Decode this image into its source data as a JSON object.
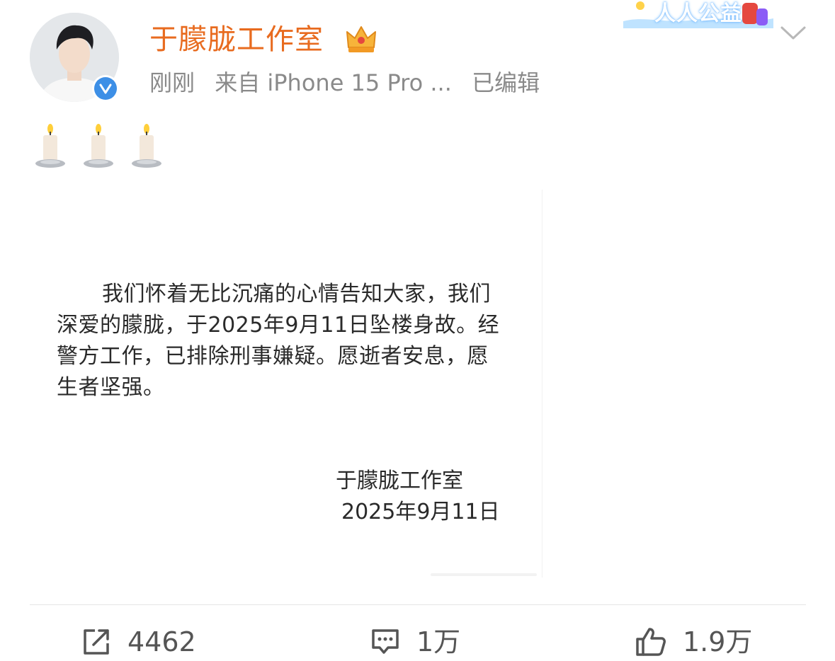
{
  "header": {
    "username": "于朦胧工作室",
    "meta": {
      "time": "刚刚",
      "source": "来自 iPhone 15 Pro ...",
      "edited": "已编辑"
    },
    "banner_text": "人人公益",
    "icons": [
      "avatar",
      "verified-v-icon",
      "crown-icon",
      "chevron-down-icon"
    ]
  },
  "post": {
    "emoji": [
      "candle",
      "candle",
      "candle"
    ],
    "notice": {
      "body": "我们怀着无比沉痛的心情告知大家，我们深爱的朦胧，于2025年9月11日坠楼身故。经警方工作，已排除刑事嫌疑。愿逝者安息，愿生者坚强。",
      "signature": "于朦胧工作室",
      "date": "2025年9月11日"
    }
  },
  "actions": {
    "repost_count": "4462",
    "comment_count": "1万",
    "like_count": "1.9万",
    "icons": [
      "share-icon",
      "comment-icon",
      "like-icon"
    ]
  },
  "colors": {
    "username": "#e86b1f",
    "meta": "#8a8a8a",
    "verified": "#3d8fe6",
    "action": "#555555"
  }
}
